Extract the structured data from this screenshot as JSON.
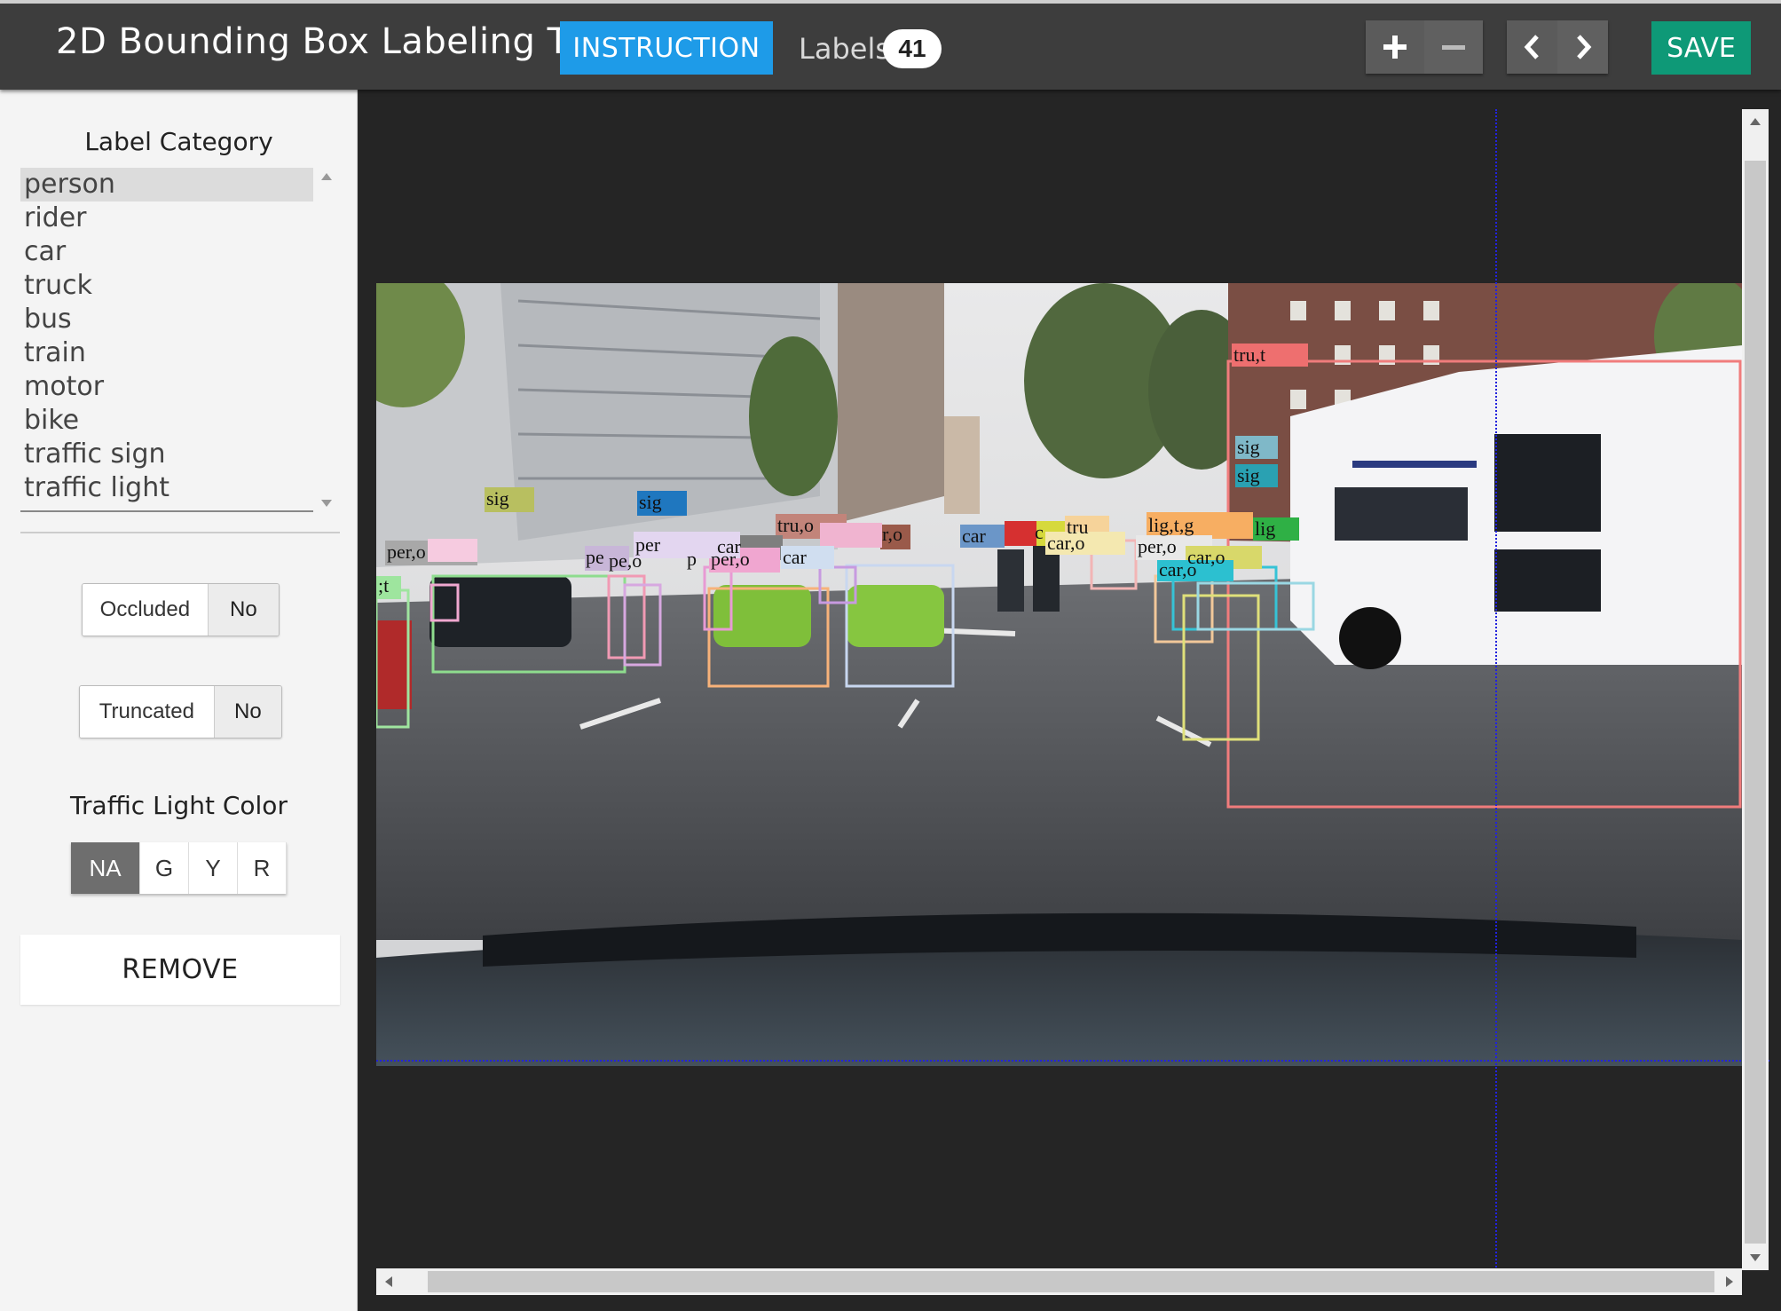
{
  "app": {
    "title": "2D Bounding Box Labeling Tool",
    "instruction_label": "INSTRUCTION",
    "labels_text": "Labels",
    "labels_count": "41",
    "save_label": "SAVE"
  },
  "toolbar": {
    "zoom_in_icon": "plus-icon",
    "zoom_out_icon": "minus-icon",
    "prev_icon": "chevron-left-icon",
    "next_icon": "chevron-right-icon"
  },
  "sidebar": {
    "category_title": "Label Category",
    "categories": [
      "person",
      "rider",
      "car",
      "truck",
      "bus",
      "train",
      "motor",
      "bike",
      "traffic sign",
      "traffic light"
    ],
    "selected_category": "person",
    "occluded": {
      "label": "Occluded",
      "value": "No"
    },
    "truncated": {
      "label": "Truncated",
      "value": "No"
    },
    "traffic_light_title": "Traffic Light Color",
    "traffic_light_options": [
      "NA",
      "G",
      "Y",
      "R"
    ],
    "traffic_light_selected": "NA",
    "remove_label": "REMOVE"
  },
  "colors": {
    "topbar": "#3d3d3d",
    "instruction": "#1e9be8",
    "save": "#0e9977",
    "guide": "#2222dd"
  },
  "annotations": {
    "labels": [
      "tru,t",
      "sig",
      "sig",
      "lig",
      "lig,t,g",
      "tru",
      "c",
      "car,o",
      "per,o",
      "car",
      "car,o",
      "car,o",
      "car",
      "tru,o",
      "r,o",
      "sig",
      "per",
      "pe",
      "per,o",
      "p",
      "pe,o",
      "sig",
      "per,o",
      "car",
      ";t"
    ]
  }
}
